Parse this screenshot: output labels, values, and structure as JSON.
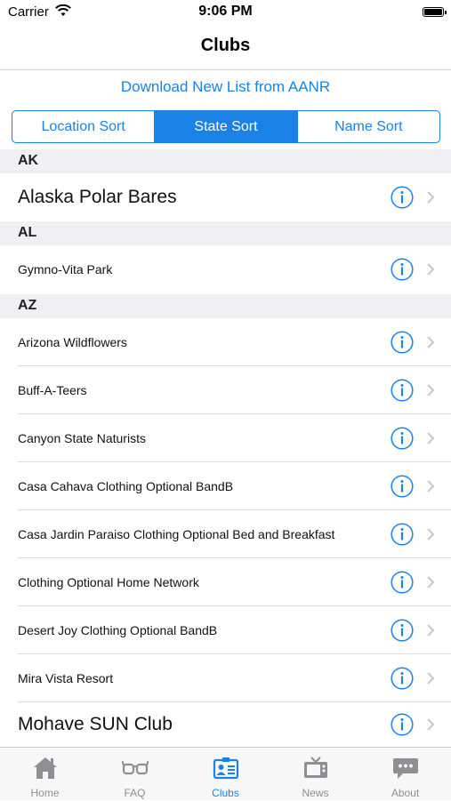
{
  "status_bar": {
    "carrier": "Carrier",
    "time": "9:06 PM"
  },
  "nav": {
    "title": "Clubs"
  },
  "download_link": "Download New List from AANR",
  "sort_tabs": [
    {
      "label": "Location Sort",
      "active": false
    },
    {
      "label": "State Sort",
      "active": true
    },
    {
      "label": "Name Sort",
      "active": false
    }
  ],
  "sections": [
    {
      "header": "AK",
      "rows": [
        {
          "name": "Alaska Polar Bares",
          "large": true
        }
      ]
    },
    {
      "header": "AL",
      "rows": [
        {
          "name": "Gymno-Vita Park"
        }
      ]
    },
    {
      "header": "AZ",
      "rows": [
        {
          "name": "Arizona Wildflowers"
        },
        {
          "name": "Buff-A-Teers"
        },
        {
          "name": "Canyon State Naturists"
        },
        {
          "name": "Casa Cahava Clothing Optional BandB"
        },
        {
          "name": "Casa Jardin Paraiso Clothing Optional Bed and Breakfast"
        },
        {
          "name": "Clothing Optional Home Network"
        },
        {
          "name": "Desert Joy Clothing Optional BandB"
        },
        {
          "name": "Mira Vista Resort"
        },
        {
          "name": "Mohave SUN Club",
          "large": true
        }
      ]
    }
  ],
  "tabs": [
    {
      "label": "Home",
      "icon": "home-icon"
    },
    {
      "label": "FAQ",
      "icon": "glasses-icon"
    },
    {
      "label": "Clubs",
      "icon": "id-card-icon",
      "active": true
    },
    {
      "label": "News",
      "icon": "tv-icon"
    },
    {
      "label": "About",
      "icon": "speech-bubble-icon"
    }
  ],
  "colors": {
    "accent": "#1a82e6",
    "section_bg": "#efeff4",
    "tab_inactive": "#8e8e93"
  }
}
